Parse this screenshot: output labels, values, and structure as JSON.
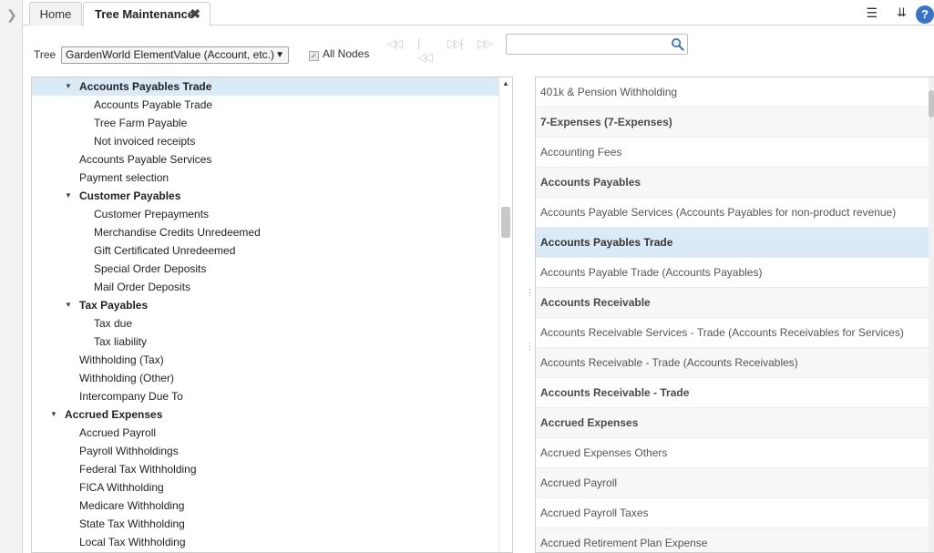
{
  "tabs": {
    "home": "Home",
    "active": "Tree Maintenance",
    "close_glyph": "✖"
  },
  "header_icons": [
    "menu-icon",
    "chevron-double-down-icon",
    "help-icon"
  ],
  "toolbar": {
    "tree_label": "Tree",
    "tree_value": "GardenWorld ElementValue (Account, etc.)",
    "all_nodes_label": "All Nodes",
    "all_nodes_checked": true,
    "search_value": ""
  },
  "tree": [
    {
      "label": "Accounts Payables Trade",
      "level": 2,
      "expanded": true,
      "bold": true,
      "selected": true
    },
    {
      "label": "Accounts Payable Trade",
      "level": 3
    },
    {
      "label": "Tree Farm Payable",
      "level": 3
    },
    {
      "label": "Not invoiced receipts",
      "level": 3
    },
    {
      "label": "Accounts Payable Services",
      "level": 2
    },
    {
      "label": "Payment selection",
      "level": 2
    },
    {
      "label": "Customer Payables",
      "level": 2,
      "expanded": true,
      "bold": true
    },
    {
      "label": "Customer Prepayments",
      "level": 3
    },
    {
      "label": "Merchandise Credits Unredeemed",
      "level": 3
    },
    {
      "label": "Gift Certificated Unredeemed",
      "level": 3
    },
    {
      "label": "Special Order Deposits",
      "level": 3
    },
    {
      "label": "Mail Order Deposits",
      "level": 3
    },
    {
      "label": "Tax Payables",
      "level": 2,
      "expanded": true,
      "bold": true
    },
    {
      "label": "Tax due",
      "level": 3
    },
    {
      "label": "Tax liability",
      "level": 3
    },
    {
      "label": "Withholding (Tax)",
      "level": 2
    },
    {
      "label": "Withholding (Other)",
      "level": 2
    },
    {
      "label": "Intercompany Due To",
      "level": 2
    },
    {
      "label": "Accrued Expenses",
      "level": 1,
      "expanded": true,
      "bold": true
    },
    {
      "label": "Accrued Payroll",
      "level": 2
    },
    {
      "label": "Payroll Withholdings",
      "level": 2
    },
    {
      "label": "Federal Tax Withholding",
      "level": 2
    },
    {
      "label": "FICA Withholding",
      "level": 2
    },
    {
      "label": "Medicare Withholding",
      "level": 2
    },
    {
      "label": "State Tax Withholding",
      "level": 2
    },
    {
      "label": "Local Tax Withholding",
      "level": 2
    }
  ],
  "list": [
    {
      "label": "401k & Pension Withholding"
    },
    {
      "label": "7-Expenses (7-Expenses)",
      "bold": true
    },
    {
      "label": "Accounting Fees"
    },
    {
      "label": "Accounts Payables",
      "bold": true
    },
    {
      "label": "Accounts Payable Services (Accounts Payables for non-product revenue)"
    },
    {
      "label": "Accounts Payables Trade",
      "bold": true,
      "selected": true
    },
    {
      "label": "Accounts Payable Trade (Accounts Payables)"
    },
    {
      "label": "Accounts Receivable",
      "bold": true
    },
    {
      "label": "Accounts Receivable Services - Trade (Accounts Receivables for Services)"
    },
    {
      "label": "Accounts Receivable - Trade (Accounts Receivables)"
    },
    {
      "label": "Accounts Receivable - Trade",
      "bold": true
    },
    {
      "label": "Accrued Expenses",
      "bold": true
    },
    {
      "label": "Accrued Expenses Others"
    },
    {
      "label": "Accrued Payroll"
    },
    {
      "label": "Accrued Payroll Taxes"
    },
    {
      "label": "Accrued Retirement Plan Expense"
    }
  ]
}
